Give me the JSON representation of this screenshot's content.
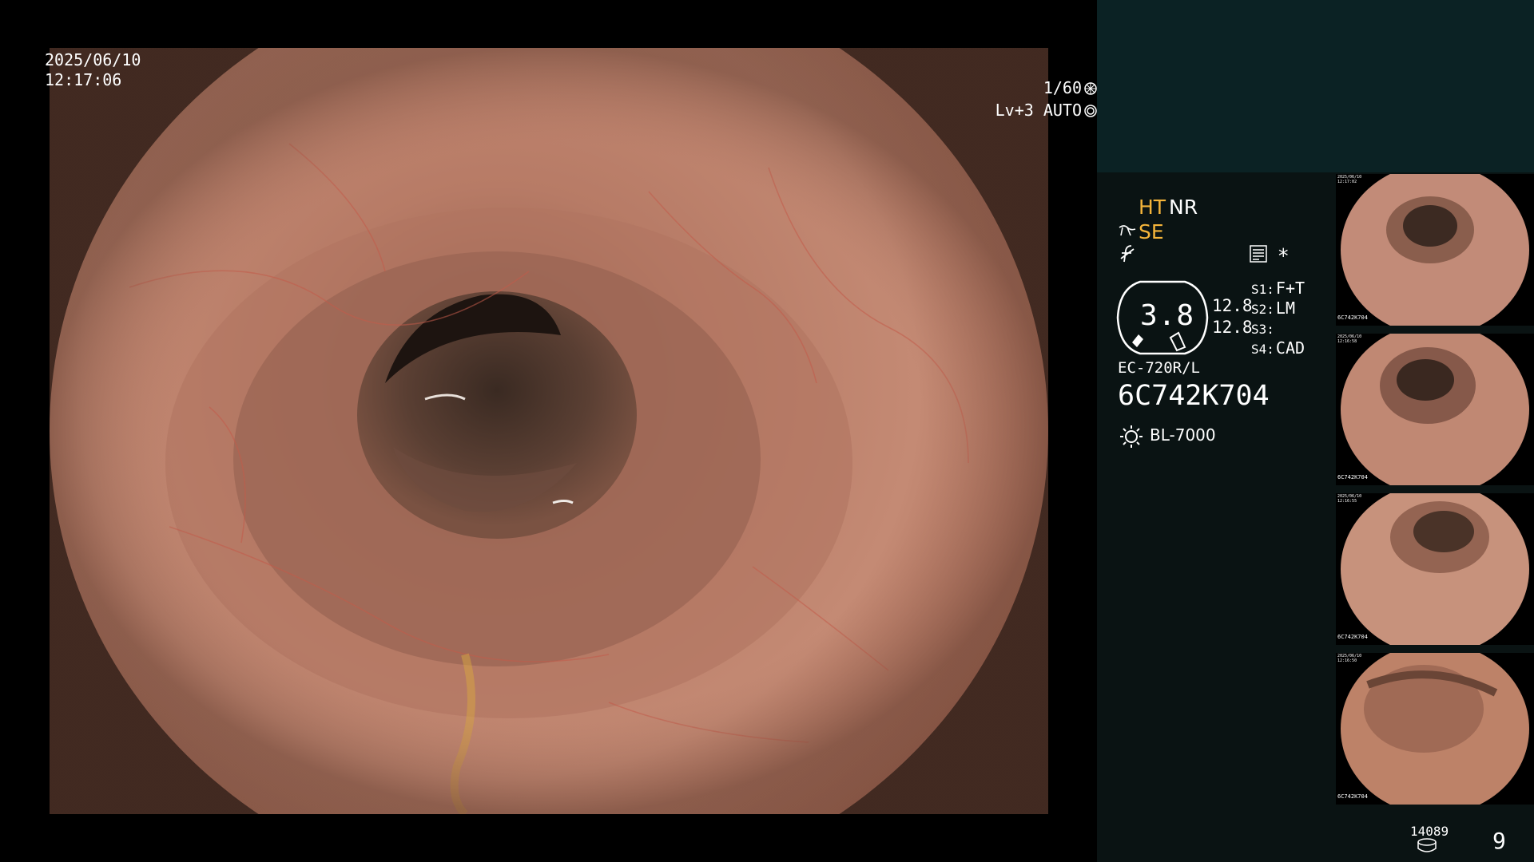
{
  "main": {
    "date": "2025/06/10",
    "time": "12:17:06",
    "shutter": "1/60",
    "level": "Lv+3 AUTO"
  },
  "panel": {
    "ht": "HT",
    "nr": "NR",
    "se": "SE",
    "star": "*",
    "gauge": {
      "value": "3.8",
      "upper": "12.8",
      "lower": "12.8"
    },
    "slots": [
      {
        "key": "S1:",
        "value": "F+T"
      },
      {
        "key": "S2:",
        "value": "LM"
      },
      {
        "key": "S3:",
        "value": ""
      },
      {
        "key": "S4:",
        "value": "CAD"
      }
    ],
    "scope_model": "EC-720R/L",
    "scope_serial": "6C742K704",
    "light_source": "BL-7000",
    "thumbnails": [
      {
        "date": "2025/06/10",
        "time": "12:17:02",
        "id": "6C742K704"
      },
      {
        "date": "2025/06/10",
        "time": "12:16:58",
        "id": "6C742K704"
      },
      {
        "date": "2025/06/10",
        "time": "12:16:55",
        "id": "6C742K704"
      },
      {
        "date": "2025/06/10",
        "time": "12:16:50",
        "id": "6C742K704"
      }
    ],
    "image_count": "14089",
    "page_number": "9"
  },
  "colors": {
    "accent_yellow": "#f4b43a",
    "panel_bg": "#0a1313",
    "panel_top_bg": "#0b2224"
  },
  "icons": [
    "shutter-icon",
    "auto-iris-icon",
    "structure-enhance-icon",
    "freeze-icon",
    "menu-icon",
    "light-source-icon",
    "storage-disk-icon"
  ]
}
